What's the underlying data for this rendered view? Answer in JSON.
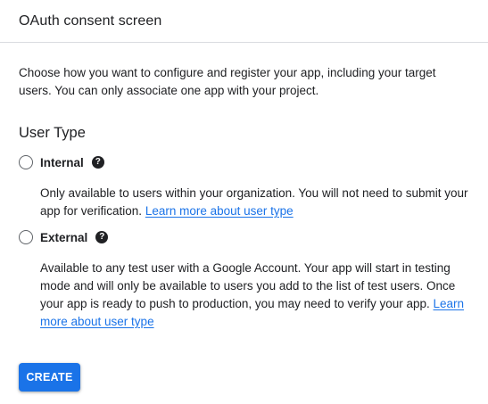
{
  "header": {
    "title": "OAuth consent screen"
  },
  "intro": {
    "text": "Choose how you want to configure and register your app, including your target users. You can only associate one app with your project."
  },
  "user_type": {
    "heading": "User Type",
    "help_icon_glyph": "?",
    "options": [
      {
        "label": "Internal",
        "selected": false,
        "description": "Only available to users within your organization. You will not need to submit your app for verification.",
        "link_text": "Learn more about user type"
      },
      {
        "label": "External",
        "selected": false,
        "description": "Available to any test user with a Google Account. Your app will start in testing mode and will only be available to users you add to the list of test users. Once your app is ready to push to production, you may need to verify your app.",
        "link_text": "Learn more about user type"
      }
    ]
  },
  "actions": {
    "create_label": "CREATE"
  },
  "colors": {
    "accent": "#1a73e8",
    "text": "#202124",
    "divider": "#dadce0"
  }
}
